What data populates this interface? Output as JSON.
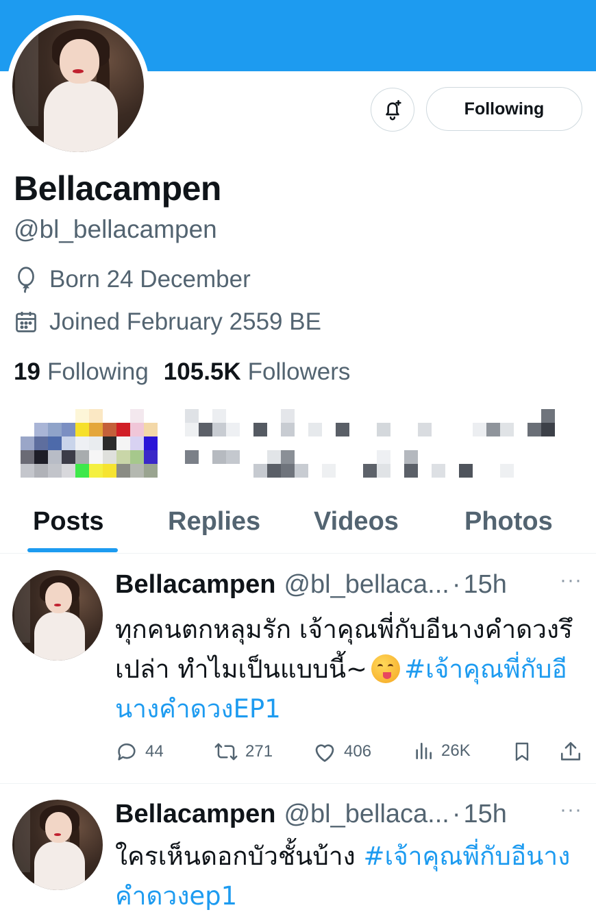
{
  "profile": {
    "display_name": "Bellacampen",
    "handle": "@bl_bellacampen",
    "born": "Born 24 December",
    "joined": "Joined February 2559 BE",
    "following_count": "19",
    "following_label": "Following",
    "followers_count": "105.5K",
    "followers_label": "Followers",
    "follow_button_label": "Following"
  },
  "icons": {
    "bell": "bell-plus-icon",
    "balloon": "balloon-icon",
    "calendar": "calendar-icon",
    "reply": "reply-icon",
    "repost": "repost-icon",
    "like": "heart-icon",
    "views": "views-icon",
    "bookmark": "bookmark-icon",
    "share": "share-icon"
  },
  "colors": {
    "accent": "#1d9bf0",
    "text_primary": "#0f1419",
    "text_secondary": "#536471"
  },
  "tabs": [
    {
      "label": "Posts",
      "active": true
    },
    {
      "label": "Replies",
      "active": false
    },
    {
      "label": "Videos",
      "active": false
    },
    {
      "label": "Photos",
      "active": false
    }
  ],
  "posts": [
    {
      "name": "Bellacampen",
      "handle": "@bl_bellaca...",
      "separator": "·",
      "time": "15h",
      "more": "···",
      "text": "ทุกคนตกหลุมรัก เจ้าคุณพี่กับอีนางคำดวงรึเปล่า ทำไมเป็นแบบนี้~",
      "hashtag": "#เจ้าคุณพี่กับอีนางคำดวงEP1",
      "replies": "44",
      "reposts": "271",
      "likes": "406",
      "views": "26K"
    },
    {
      "name": "Bellacampen",
      "handle": "@bl_bellaca...",
      "separator": "·",
      "time": "15h",
      "more": "···",
      "text": "ใครเห็นดอกบัวชั้นบ้าง",
      "hashtag": "#เจ้าคุณพี่กับอีนางคำดวงep1"
    }
  ]
}
